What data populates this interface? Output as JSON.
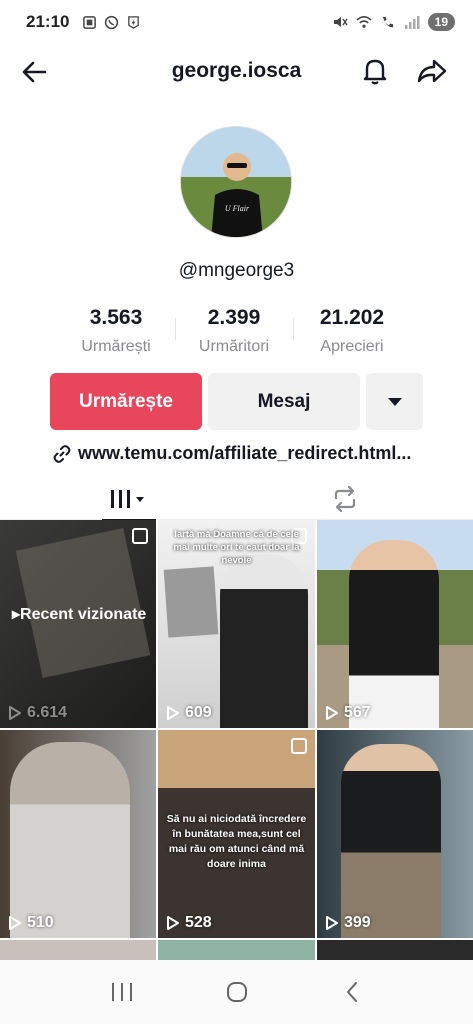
{
  "status_bar": {
    "time": "21:10",
    "battery": "19",
    "left_icons": [
      "screenshot-icon",
      "whatsapp-icon",
      "bolt-icon"
    ],
    "right_icons": [
      "mute-icon",
      "wifi-icon",
      "call-icon",
      "signal-icon"
    ]
  },
  "header": {
    "title": "george.iosca",
    "back_icon": "arrow-left-icon",
    "bell_icon": "bell-icon",
    "share_icon": "share-icon"
  },
  "profile": {
    "username": "@mngeorge3",
    "stats": [
      {
        "value": "3.563",
        "label": "Urmărești"
      },
      {
        "value": "2.399",
        "label": "Urmăritori"
      },
      {
        "value": "21.202",
        "label": "Aprecieri"
      }
    ],
    "follow_label": "Urmărește",
    "message_label": "Mesaj",
    "link_text": "www.temu.com/affiliate_redirect.html..."
  },
  "videos": [
    {
      "views": "6.614",
      "badge": "Recent vizionate",
      "caption": ""
    },
    {
      "views": "609",
      "caption": "Iartă mă Doamne că de cele mai multe ori te caut doar la nevoie"
    },
    {
      "views": "567",
      "caption": ""
    },
    {
      "views": "510",
      "caption": ""
    },
    {
      "views": "528",
      "caption": "Să nu ai niciodată încredere în bunătatea mea,sunt cel mai rău om atunci când mă doare inima"
    },
    {
      "views": "399",
      "caption": ""
    }
  ],
  "colors": {
    "accent": "#e8465b",
    "button_bg": "#f1f1f2",
    "text": "#161823",
    "muted": "#8a8b91"
  }
}
